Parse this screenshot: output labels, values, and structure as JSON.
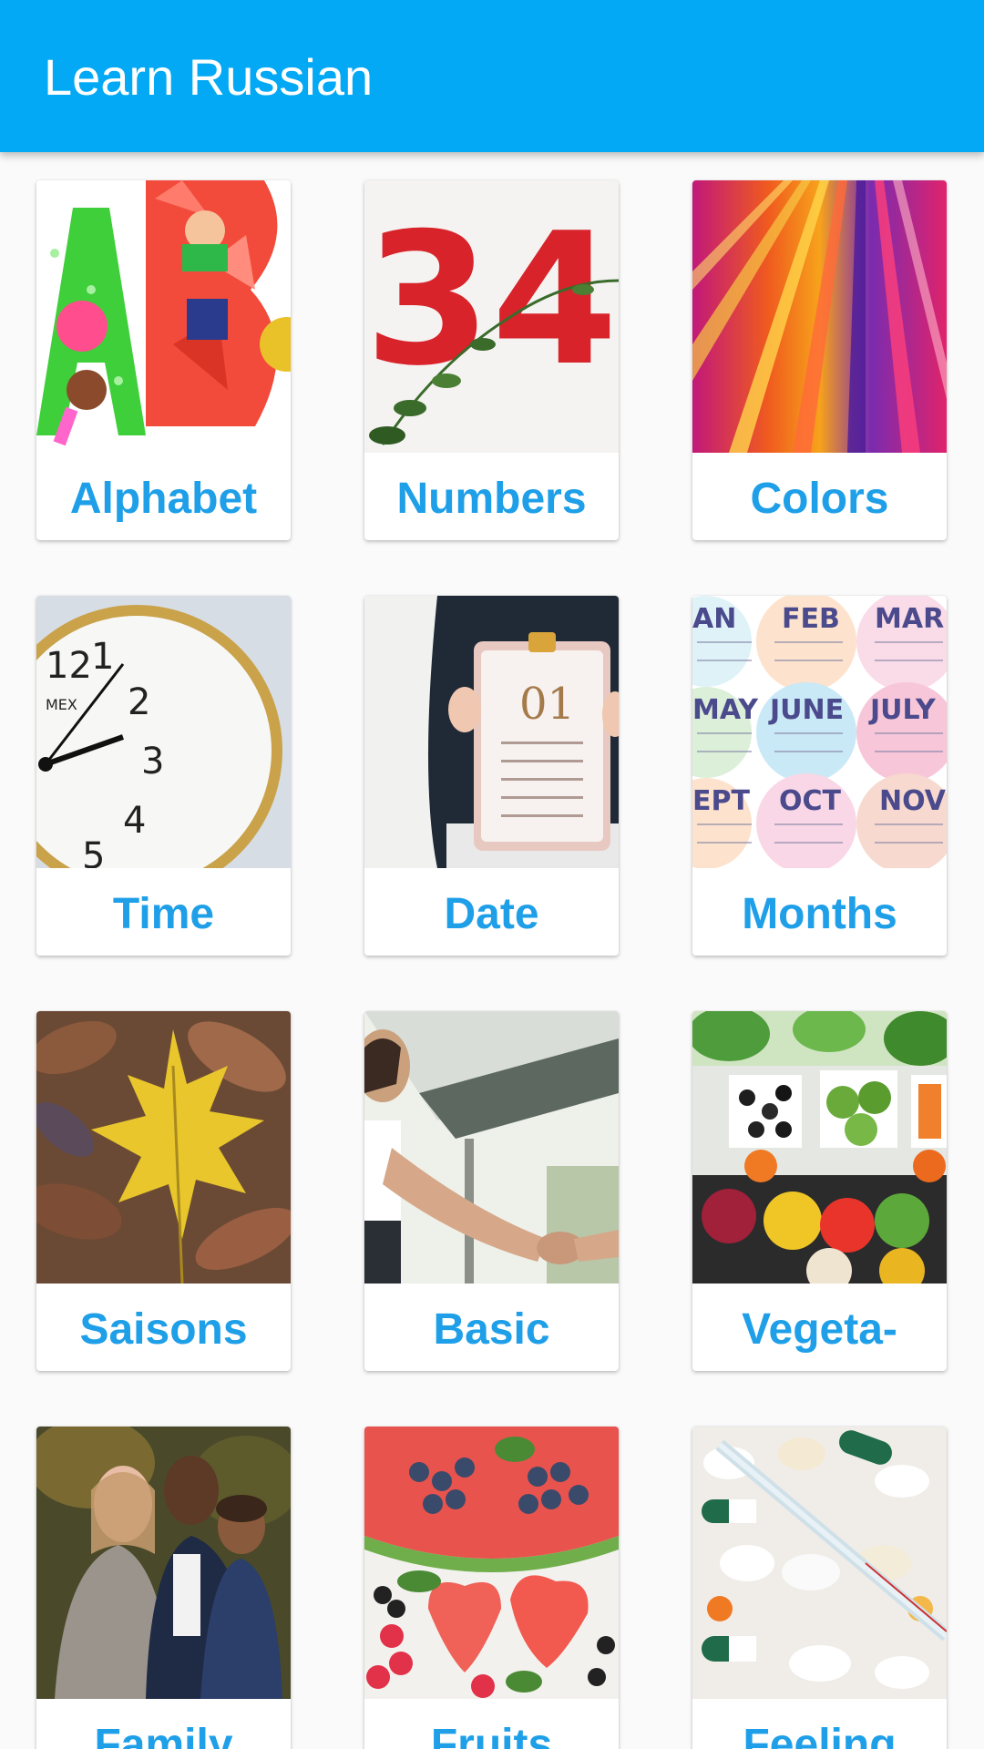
{
  "app_bar": {
    "title": "Learn Russian",
    "color": "#03a9f4"
  },
  "accent_label_color": "#1e9fe8",
  "categories": [
    {
      "label": "Alphabet",
      "image": "alphabet-letters-image"
    },
    {
      "label": "Numbers",
      "image": "numbers-image"
    },
    {
      "label": "Colors",
      "image": "colored-straws-image"
    },
    {
      "label": "Time",
      "image": "alarm-clock-image"
    },
    {
      "label": "Date",
      "image": "calendar-clipboard-image"
    },
    {
      "label": "Months",
      "image": "months-calendar-image"
    },
    {
      "label": "Saisons",
      "image": "autumn-leaves-image"
    },
    {
      "label": "Basic",
      "image": "handshake-image"
    },
    {
      "label": "Vegeta-",
      "image": "vegetables-image"
    },
    {
      "label": "Family",
      "image": "family-photo-image"
    },
    {
      "label": "Fruits",
      "image": "fruits-image"
    },
    {
      "label": "Feeling",
      "image": "pills-thermometer-image"
    }
  ],
  "months_image_text": [
    "AN",
    "FEB",
    "MAR",
    "MAY",
    "JUNE",
    "JULY",
    "EPT",
    "OCT",
    "NOV"
  ],
  "clock_text": "MEX",
  "date_text": "01"
}
